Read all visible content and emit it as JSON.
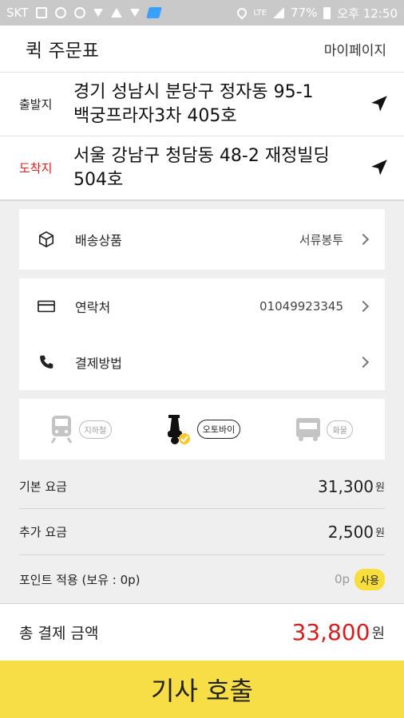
{
  "status_bar": {
    "carrier": "SKT",
    "network": "LTE",
    "battery": "77%",
    "time": "오후 12:50"
  },
  "header": {
    "title": "퀵 주문표",
    "mypage_label": "마이페이지"
  },
  "origin": {
    "label": "출발지",
    "address_line1": "경기 성남시 분당구 정자동 95-1",
    "address_line2": "백궁프라자3차  405호"
  },
  "destination": {
    "label": "도착지",
    "address_line1": "서울 강남구 청담동 48-2 재정빌딩",
    "address_line2": "504호"
  },
  "product": {
    "label": "배송상품",
    "value": "서류봉투"
  },
  "contact": {
    "label": "연락처",
    "value": "01049923345"
  },
  "payment": {
    "label": "결제방법",
    "value": ""
  },
  "vehicles": [
    {
      "label": "지하철",
      "icon": "subway-icon",
      "selected": false
    },
    {
      "label": "오토바이",
      "icon": "motorbike-icon",
      "selected": true
    },
    {
      "label": "화물",
      "icon": "truck-icon",
      "selected": false
    }
  ],
  "fees": {
    "base_label": "기본 요금",
    "base_value": "31,300",
    "extra_label": "추가 요금",
    "extra_value": "2,500",
    "unit": "원",
    "points_label": "포인트 적용 (보유 : 0p)",
    "points_value": "0p",
    "use_label": "사용"
  },
  "total": {
    "label": "총 결제 금액",
    "value": "33,800",
    "unit": "원"
  },
  "call_button": "기사 호출",
  "colors": {
    "accent_yellow": "#f7de47",
    "price_red": "#d41f1f",
    "dest_label_red": "#d92020"
  }
}
